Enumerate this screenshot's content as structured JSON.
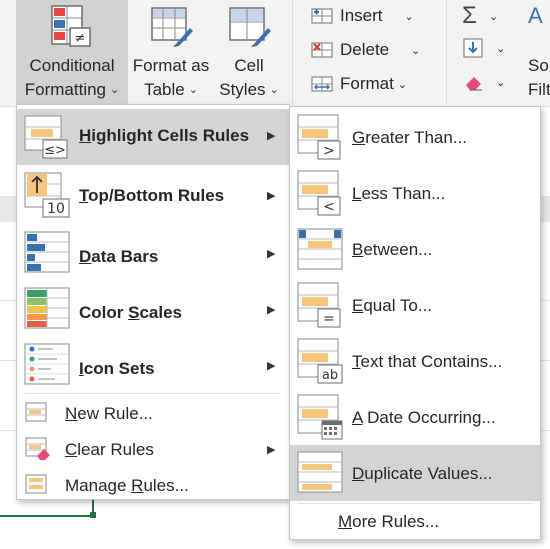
{
  "ribbon": {
    "conditional_formatting": {
      "line1": "Conditional",
      "line2": "Formatting"
    },
    "format_as_table": {
      "line1": "Format as",
      "line2": "Table"
    },
    "cell_styles": {
      "line1": "Cell",
      "line2": "Styles"
    },
    "insert": "Insert",
    "delete": "Delete",
    "format": "Format",
    "sort_partial_1": "So",
    "sort_partial_2": "Filt",
    "chevron": "⌄"
  },
  "main_menu": {
    "items": [
      {
        "pre": "",
        "key": "H",
        "post": "ighlight Cells Rules",
        "icon": "highlight-cells-icon"
      },
      {
        "pre": "",
        "key": "T",
        "post": "op/Bottom Rules",
        "icon": "top-bottom-icon"
      },
      {
        "pre": "",
        "key": "D",
        "post": "ata Bars",
        "icon": "data-bars-icon"
      },
      {
        "pre": "Color ",
        "key": "S",
        "post": "cales",
        "icon": "color-scales-icon"
      },
      {
        "pre": "",
        "key": "I",
        "post": "con Sets",
        "icon": "icon-sets-icon"
      }
    ],
    "actions": [
      {
        "pre": "",
        "key": "N",
        "post": "ew Rule...",
        "icon": "new-rule-icon"
      },
      {
        "pre": "",
        "key": "C",
        "post": "lear Rules",
        "icon": "clear-rules-icon"
      },
      {
        "pre": "Manage ",
        "key": "R",
        "post": "ules...",
        "icon": "manage-rules-icon"
      }
    ],
    "top_bottom_number": "10"
  },
  "sub_menu": {
    "items": [
      {
        "pre": "",
        "key": "G",
        "post": "reater Than...",
        "symbol": ">"
      },
      {
        "pre": "",
        "key": "L",
        "post": "ess Than...",
        "symbol": "<"
      },
      {
        "pre": "",
        "key": "B",
        "post": "etween...",
        "symbol": ""
      },
      {
        "pre": "",
        "key": "E",
        "post": "qual To...",
        "symbol": "="
      },
      {
        "pre": "",
        "key": "T",
        "post": "ext that Contains...",
        "symbol": "ab"
      },
      {
        "pre": "",
        "key": "A",
        "post": " Date Occurring...",
        "symbol": ""
      },
      {
        "pre": "",
        "key": "D",
        "post": "uplicate Values...",
        "symbol": ""
      }
    ],
    "more": {
      "pre": "",
      "key": "M",
      "post": "ore Rules..."
    }
  },
  "colors": {
    "accent_green": "#217346",
    "highlight_yellow": "#f5c77e",
    "bar_blue": "#3a6fb0",
    "menu_hover": "#d4d4d4"
  }
}
